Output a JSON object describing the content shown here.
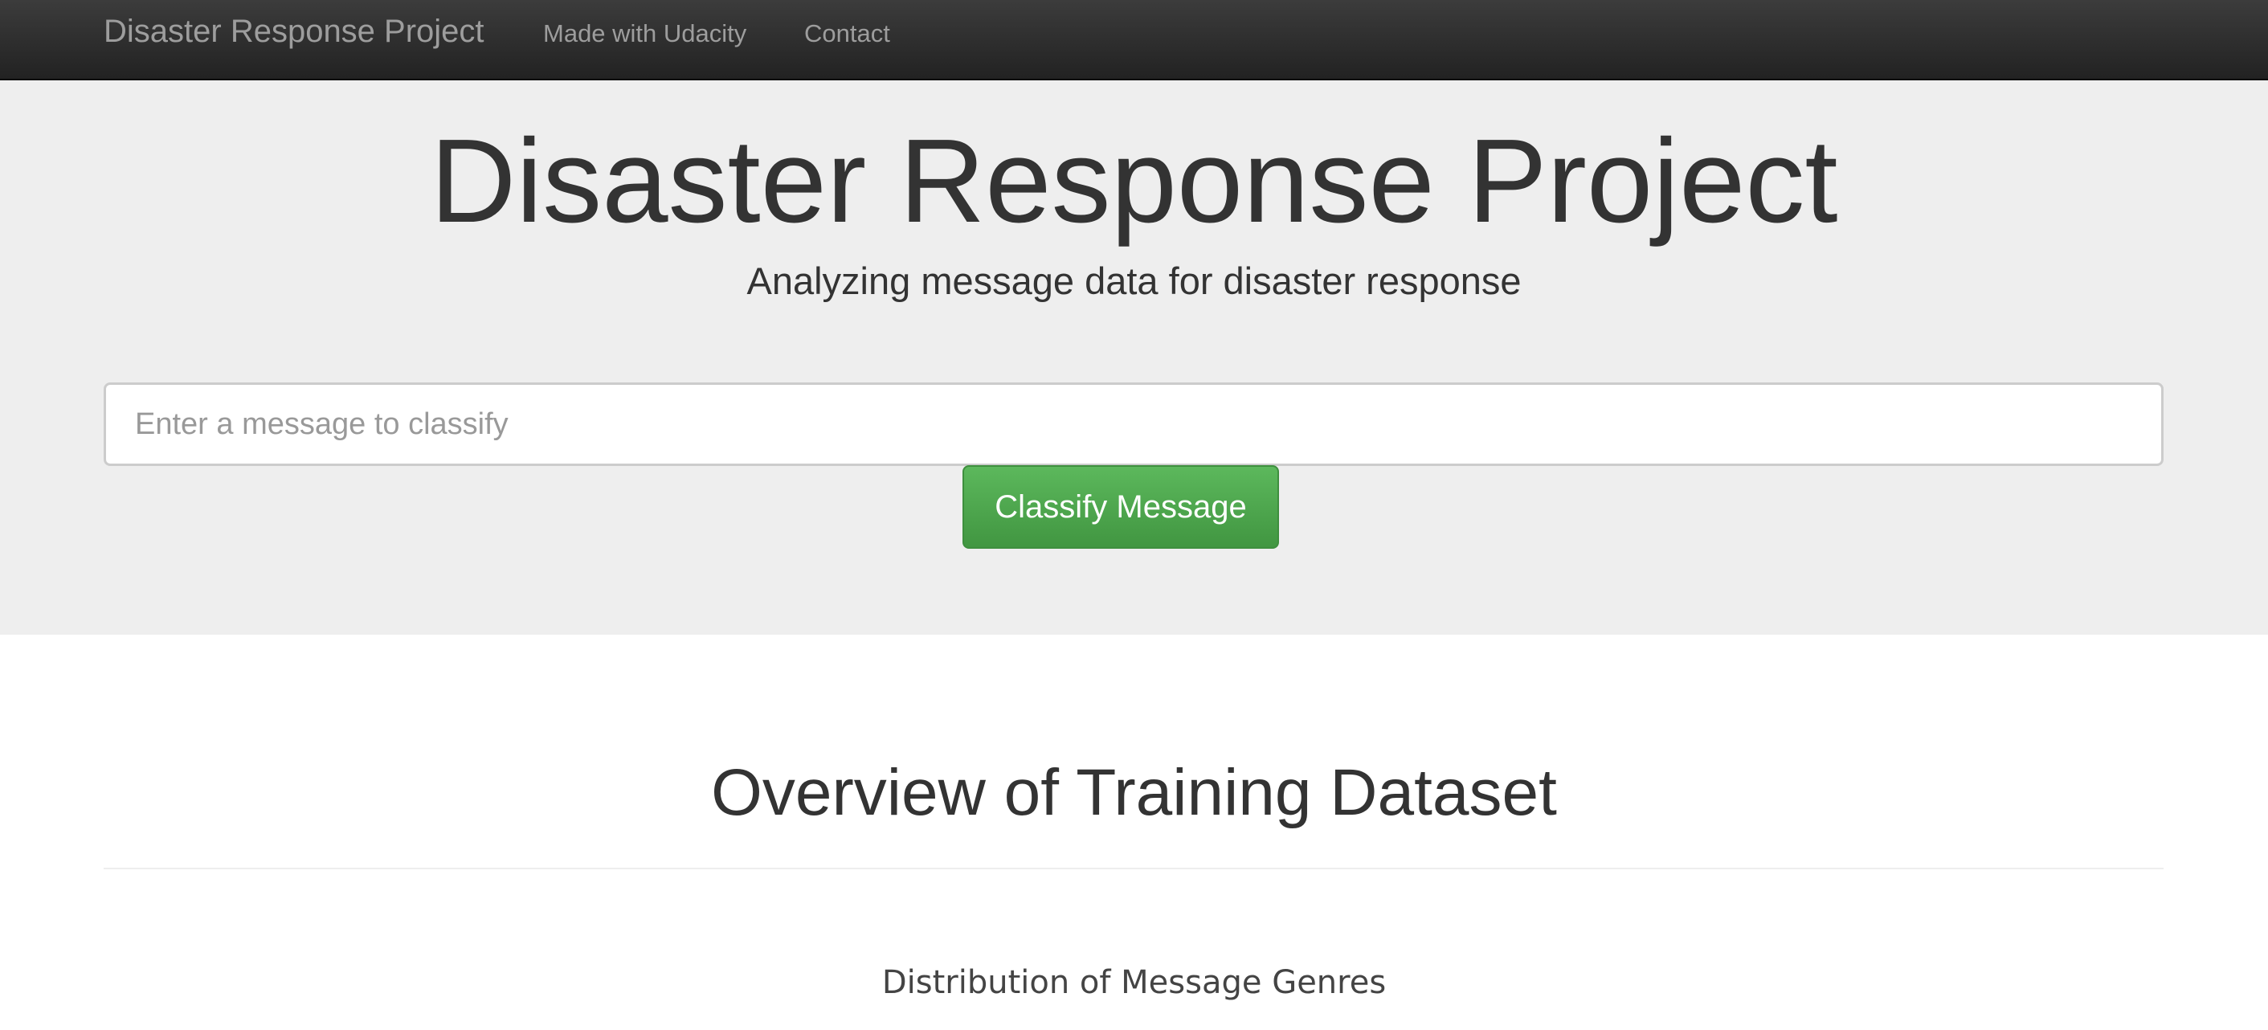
{
  "navbar": {
    "brand": "Disaster Response Project",
    "links": [
      {
        "label": "Made with Udacity"
      },
      {
        "label": "Contact"
      }
    ],
    "background": "#222222",
    "link_color": "#9d9d9d"
  },
  "hero": {
    "title": "Disaster Response Project",
    "subtitle": "Analyzing message data for disaster response",
    "background": "#eeeeee"
  },
  "classify_form": {
    "input_value": "",
    "input_placeholder": "Enter a message to classify",
    "button_label": "Classify Message",
    "button_color": "#5cb85c"
  },
  "overview": {
    "title": "Overview of Training Dataset",
    "chart_title": "Distribution of Message Genres"
  }
}
